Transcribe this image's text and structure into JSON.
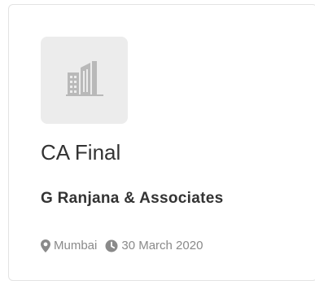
{
  "job_card": {
    "title": "CA Final",
    "company": "G Ranjana & Associates",
    "location": "Mumbai",
    "posted_date": "30 March 2020",
    "logo_icon": "building-icon",
    "location_icon": "map-marker-icon",
    "date_icon": "clock-icon"
  },
  "colors": {
    "card_border": "#e3e3e3",
    "logo_background": "#ececec",
    "logo_icon": "#b9b9b9",
    "title_text": "#333333",
    "meta_text": "#8a8a8a"
  }
}
